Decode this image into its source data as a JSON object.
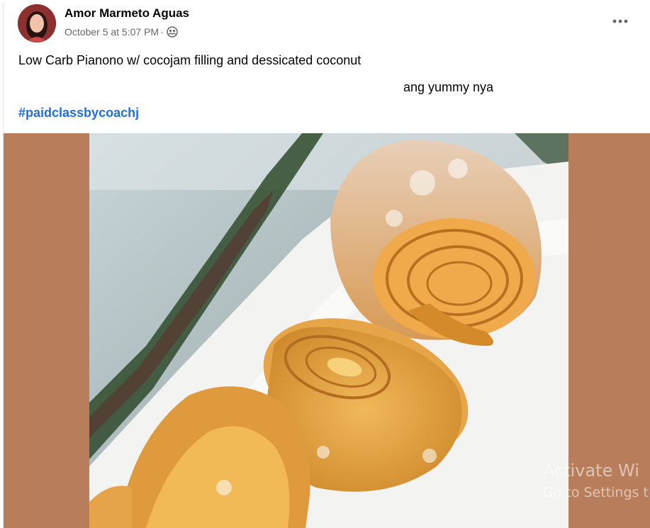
{
  "post": {
    "author": "Amor Marmeto Aguas",
    "timestamp": "October 5 at 5:07 PM",
    "separator": "·",
    "audience_icon": "friends-of-friends-icon",
    "more_icon": "more-options-icon",
    "text_line1": "Low Carb Pianono w/ cocojam filling and dessicated coconut",
    "text_line2": "ang yummy nya",
    "hashtag": "#paidclassbycoachj",
    "photo_description": "rolled sponge cake slices with caramel filling on a white plate"
  },
  "overlay": {
    "activate_title": "Activate Wi",
    "activate_subtitle": "Go to Settings t"
  },
  "colors": {
    "link": "#216fdb",
    "meta_text": "#65676b",
    "media_background": "#b87d5a"
  }
}
